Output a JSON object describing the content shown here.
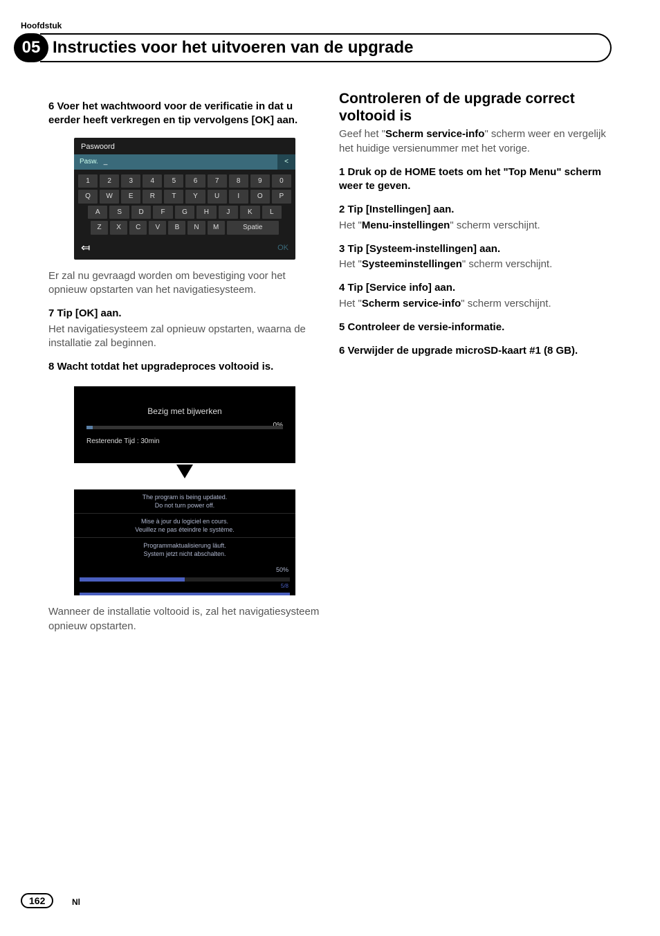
{
  "header": {
    "top_label": "Hoofdstuk",
    "chapter_num": "05",
    "chapter_title": "Instructies voor het uitvoeren van de upgrade"
  },
  "left": {
    "step6": "6   Voer het wachtwoord voor de verificatie in dat u eerder heeft verkregen en tip vervolgens [OK] aan.",
    "kbd": {
      "title": "Paswoord",
      "field_label": "Pasw.",
      "cursor": "_",
      "del": "<",
      "row1": [
        "1",
        "2",
        "3",
        "4",
        "5",
        "6",
        "7",
        "8",
        "9",
        "0"
      ],
      "row2": [
        "Q",
        "W",
        "E",
        "R",
        "T",
        "Y",
        "U",
        "I",
        "O",
        "P"
      ],
      "row3": [
        "A",
        "S",
        "D",
        "F",
        "G",
        "H",
        "J",
        "K",
        "L"
      ],
      "row4": [
        "Z",
        "X",
        "C",
        "V",
        "B",
        "N",
        "M",
        "Spatie"
      ],
      "back": "⤆",
      "ok": "OK"
    },
    "after_kbd": "Er zal nu gevraagd worden om bevestiging voor het opnieuw opstarten van het navigatiesysteem.",
    "step7": "7   Tip [OK] aan.",
    "step7_body": "Het navigatiesysteem zal opnieuw opstarten, waarna de installatie zal beginnen.",
    "step8": "8   Wacht totdat het upgradeproces voltooid is.",
    "prog1": {
      "title": "Bezig met bijwerken",
      "pct": "0%",
      "time": "Resterende Tijd : 30min"
    },
    "prog2": {
      "l1a": "The program is being updated.",
      "l1b": "Do not turn power off.",
      "l2a": "Mise à jour du logiciel en cours.",
      "l2b": "Veuillez ne pas éteindre le système.",
      "l3a": "Programmaktualisierung läuft.",
      "l3b": "System jetzt nicht abschalten.",
      "pct": "50%",
      "sub": "5/8"
    },
    "after_prog": "Wanneer de installatie voltooid is, zal het navigatiesysteem opnieuw opstarten."
  },
  "right": {
    "heading": "Controleren of de upgrade correct voltooid is",
    "intro_pre": "Geef het \"",
    "intro_bold": "Scherm service-info",
    "intro_post": "\" scherm weer en vergelijk het huidige versienummer met het vorige.",
    "s1": "1   Druk op de HOME toets om het \"Top Menu\" scherm weer te geven.",
    "s2": "2   Tip [Instellingen] aan.",
    "s2b_pre": "Het \"",
    "s2b_bold": "Menu-instellingen",
    "s2b_post": "\" scherm verschijnt.",
    "s3": "3   Tip [Systeem-instellingen] aan.",
    "s3b_pre": "Het \"",
    "s3b_bold": "Systeeminstellingen",
    "s3b_post": "\" scherm verschijnt.",
    "s4": "4   Tip [Service info] aan.",
    "s4b_pre": "Het \"",
    "s4b_bold": "Scherm service-info",
    "s4b_post": "\" scherm verschijnt.",
    "s5": "5   Controleer de versie-informatie.",
    "s6": "6   Verwijder de upgrade microSD-kaart #1 (8 GB)."
  },
  "footer": {
    "page": "162",
    "lang": "Nl"
  }
}
